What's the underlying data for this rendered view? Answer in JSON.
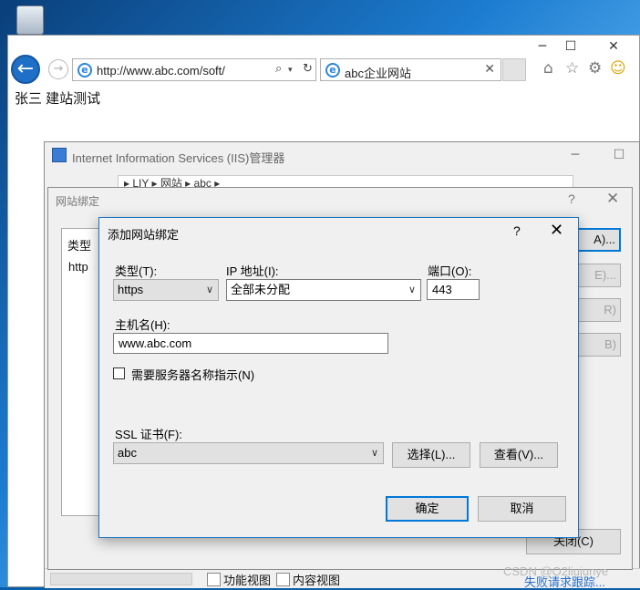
{
  "browser": {
    "url": "http://www.abc.com/soft/",
    "tab_title": "abc企业网站",
    "page_text": "张三 建站测试",
    "window_controls": {
      "minimize": "─",
      "maximize": "☐",
      "close": "✕"
    },
    "icons": [
      "back-arrow-icon",
      "forward-arrow-icon",
      "ie-logo-icon",
      "search-icon",
      "refresh-icon",
      "home-icon",
      "favorites-star-icon",
      "settings-gear-icon",
      "smiley-feedback-icon"
    ]
  },
  "iis": {
    "title": "Internet Information Services (IIS)管理器",
    "breadcrumb": "▸ LIY ▸ 网站 ▸ abc ▸",
    "bottom": {
      "feature_view": "功能视图",
      "content_view": "内容视图",
      "status": "失败请求跟踪..."
    }
  },
  "site_binding": {
    "title": "网站绑定",
    "help": "?",
    "close": "✕",
    "list": {
      "header_type": "类型",
      "row_type": "http"
    },
    "buttons": {
      "add": "A)...",
      "edit": "E)...",
      "remove": "R)",
      "browse": "B)"
    },
    "close_button": "关闭(C)"
  },
  "add_binding": {
    "title": "添加网站绑定",
    "help": "?",
    "close": "✕",
    "type_label": "类型(T):",
    "type_value": "https",
    "ip_label": "IP 地址(I):",
    "ip_value": "全部未分配",
    "port_label": "端口(O):",
    "port_value": "443",
    "host_label": "主机名(H):",
    "host_value": "www.abc.com",
    "sni_label": "需要服务器名称指示(N)",
    "sni_checked": false,
    "ssl_label": "SSL 证书(F):",
    "ssl_value": "abc",
    "select_button": "选择(L)...",
    "view_button": "查看(V)...",
    "ok_button": "确定",
    "cancel_button": "取消",
    "accent_color": "#0078d7"
  },
  "watermark": "CSDN @O2liujunye"
}
